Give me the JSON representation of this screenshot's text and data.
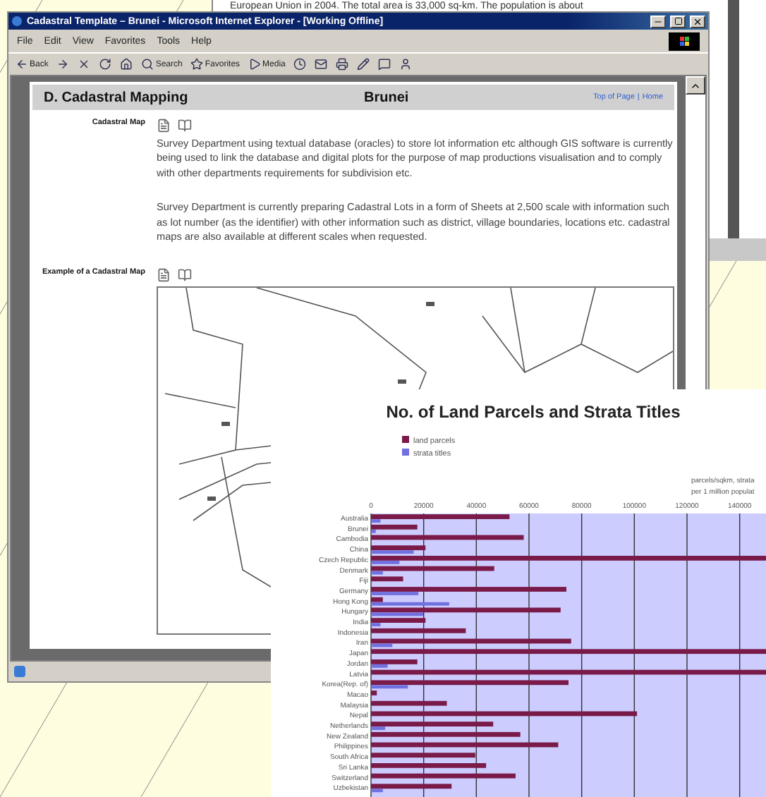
{
  "background_window": {
    "text": "European Union in 2004. The total area is 33,000 sq-km. The population is about"
  },
  "window": {
    "title": "Cadastral Template – Brunei - Microsoft Internet Explorer - [Working Offline]",
    "menu": [
      "File",
      "Edit",
      "View",
      "Favorites",
      "Tools",
      "Help"
    ],
    "toolbar": [
      {
        "kind": "back",
        "label": "Back"
      },
      {
        "kind": "forward"
      },
      {
        "kind": "stop"
      },
      {
        "kind": "refresh"
      },
      {
        "kind": "home"
      },
      {
        "kind": "search",
        "label": "Search"
      },
      {
        "kind": "favorites",
        "label": "Favorites"
      },
      {
        "kind": "media",
        "label": "Media"
      },
      {
        "kind": "history"
      },
      {
        "kind": "mail"
      },
      {
        "kind": "print"
      },
      {
        "kind": "edit"
      },
      {
        "kind": "discuss"
      },
      {
        "kind": "messenger"
      }
    ]
  },
  "page": {
    "heading": "D. Cadastral Mapping",
    "country": "Brunei",
    "links": [
      "Top of Page",
      "Home"
    ],
    "link_separator": "|",
    "sections": [
      {
        "kind": "text",
        "label": "Cadastral Map",
        "paragraphs": [
          "Survey Department using textual database (oracles) to store lot information etc although GIS software is currently being used to link the database and digital plots for the purpose of map productions visualisation and to comply with other departments requirements for subdivision etc.",
          "Survey Department is currently preparing Cadastral Lots in a form of Sheets at 2,500 scale with information such as lot number (as the identifier) with other information such as district, village boundaries, locations etc. cadastral maps are also available at different scales when requested."
        ]
      },
      {
        "kind": "picture",
        "label": "Example of a Cadastral Map"
      }
    ]
  },
  "chart": {
    "chart_data": {
      "type": "bar",
      "orientation": "horizontal",
      "title": "No. of Land Parcels and Strata Titles",
      "legend": true,
      "grid": true,
      "categories": [
        "Australia",
        "Brunei",
        "Cambodia",
        "China",
        "Czech Republic",
        "Denmark",
        "Fiji",
        "Germany",
        "Hong Kong",
        "Hungary",
        "India",
        "Indonesia",
        "Iran",
        "Japan",
        "Jordan",
        "Latvia",
        "Korea(Rep. of)",
        "Macao",
        "Malaysia",
        "Nepal",
        "Netherlands",
        "New Zealand",
        "Philippines",
        "South Africa",
        "Sri Lanka",
        "Switzerland",
        "Uzbekistan"
      ],
      "series": [
        {
          "name": "land parcels",
          "color": "#7a1a48",
          "values": [
            52600,
            17600,
            58000,
            20700,
            150000,
            46800,
            12200,
            74200,
            4500,
            72000,
            20700,
            36000,
            76000,
            150000,
            17600,
            150000,
            75000,
            2200,
            28800,
            101000,
            46400,
            56700,
            71100,
            39600,
            43700,
            54900,
            30600
          ]
        },
        {
          "name": "strata titles",
          "color": "#7070e0",
          "values": [
            3600,
            1800,
            0,
            16200,
            10800,
            4500,
            0,
            18000,
            29700,
            19800,
            3600,
            0,
            8100,
            0,
            6300,
            0,
            14000,
            0,
            0,
            0,
            5400,
            0,
            0,
            0,
            0,
            0,
            4500
          ]
        }
      ],
      "xticks": [
        0,
        20000,
        40000,
        60000,
        80000,
        100000,
        120000,
        140000
      ],
      "xlim": [
        0,
        150000
      ],
      "annotations": [
        "parcels/sqkm, strata",
        "per 1 million populat"
      ]
    }
  }
}
